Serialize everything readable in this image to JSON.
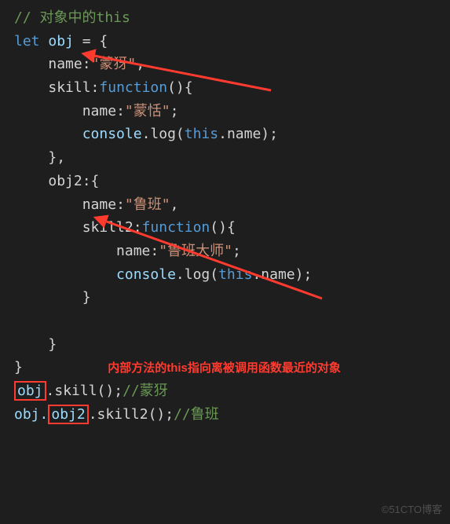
{
  "code": {
    "l1_comment": "// 对象中的this",
    "l2_let": "let",
    "l2_obj": "obj",
    "l2_rest": " = {",
    "l3_name": "name",
    "l3_val": "\"蒙犽\"",
    "l4_skill": "skill",
    "l4_func": "function",
    "l4_rest": "(){",
    "l5_name": "name",
    "l5_val": "\"蒙恬\"",
    "l5_end": ";",
    "l6_console": "console",
    "l6_log": ".log(",
    "l6_this": "this",
    "l6_nameprop": ".name);",
    "l7": "},",
    "l8_obj2": "obj2",
    "l8_rest": ":{",
    "l9_name": "name",
    "l9_val": "\"鲁班\"",
    "l10_skill2": "skill2",
    "l10_func": "function",
    "l10_rest": "(){",
    "l11_name": "name",
    "l11_val": "\"鲁班大师\"",
    "l11_end": ";",
    "l12_console": "console",
    "l12_log": ".log(",
    "l12_this": "this",
    "l12_nameprop": ".name);",
    "l13": "}",
    "l15": "}",
    "l16": "}",
    "annot_red": "内部方法的this指向离被调用函数最近的对象",
    "call1_obj": "obj",
    "call1_rest": ".skill();",
    "call1_cm": "//蒙犽",
    "call2_pre": "obj.",
    "call2_obj2": "obj2",
    "call2_rest": ".skill2();",
    "call2_cm": "//鲁班"
  },
  "watermark": "©51CTO博客"
}
